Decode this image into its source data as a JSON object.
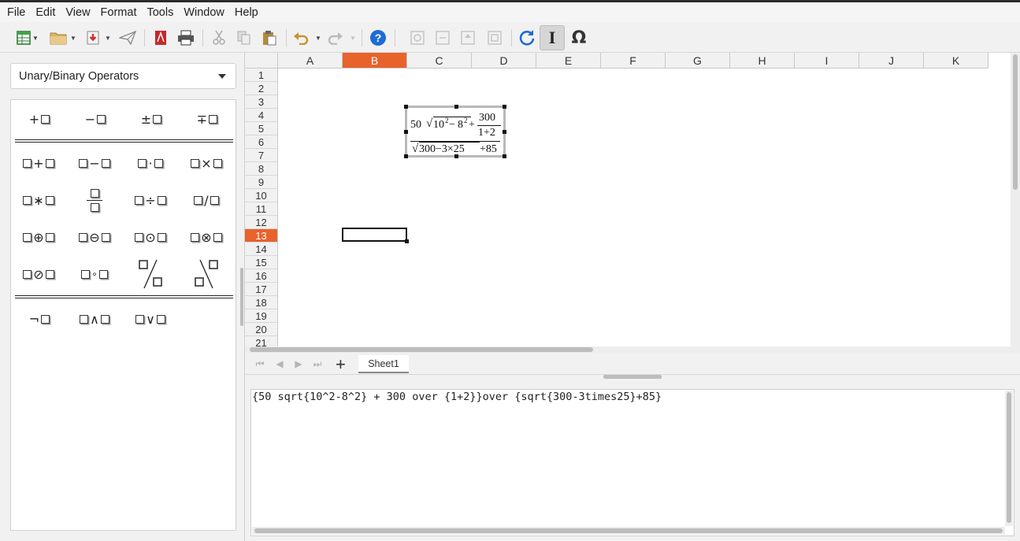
{
  "menu": [
    "File",
    "Edit",
    "View",
    "Format",
    "Tools",
    "Window",
    "Help"
  ],
  "toolbar": {
    "icons": [
      "new-document-icon",
      "open-folder-icon",
      "save-icon",
      "send-icon",
      "export-pdf-icon",
      "print-icon",
      "cut-icon",
      "copy-icon",
      "paste-icon",
      "undo-icon",
      "redo-icon",
      "help-icon",
      "zoom-in-icon",
      "zoom-out-icon",
      "zoom-100-icon",
      "show-all-icon",
      "update-icon",
      "formula-cursor-icon",
      "symbols-icon"
    ]
  },
  "elements_panel": {
    "category": "Unary/Binary Operators",
    "unary": [
      "+",
      "−",
      "±",
      "∓"
    ],
    "binary_row1": [
      "+",
      "−",
      "·",
      "×"
    ],
    "binary_row2": [
      "∗",
      "frac",
      "÷",
      "/"
    ],
    "binary_row3": [
      "⊕",
      "⊖",
      "⊙",
      "⊗"
    ],
    "binary_row4": [
      "⊘",
      "∘",
      "wideslash",
      "widebslash"
    ],
    "logic": [
      "¬",
      "∧",
      "∨"
    ]
  },
  "sheet": {
    "columns": [
      "A",
      "B",
      "C",
      "D",
      "E",
      "F",
      "G",
      "H",
      "I",
      "J",
      "K"
    ],
    "selected_column": "B",
    "rows": [
      "1",
      "2",
      "3",
      "4",
      "5",
      "6",
      "7",
      "8",
      "9",
      "10",
      "11",
      "12",
      "13",
      "14",
      "15",
      "16",
      "17",
      "18",
      "19",
      "20",
      "21"
    ],
    "selected_row": "13",
    "tab_name": "Sheet1"
  },
  "formula": {
    "num_coef": "50",
    "num_rad_base1": "10",
    "num_exp1": "2",
    "num_minus": "−",
    "num_rad_base2": "8",
    "num_exp2": "2",
    "num_plus": "+",
    "frac_top": "300",
    "frac_bottom": "1+2",
    "den_rad": "300−3×25",
    "den_tail": "+85"
  },
  "command": {
    "text": "{50 sqrt{10^2-8^2} + 300 over {1+2}}over {sqrt{300-3times25}+85}"
  },
  "colors": {
    "selection": "#e8622c"
  }
}
